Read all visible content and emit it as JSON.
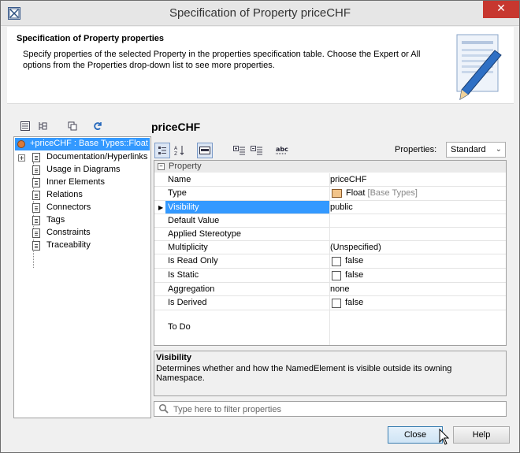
{
  "window": {
    "title": "Specification of Property priceCHF",
    "close_glyph": "✕"
  },
  "header": {
    "title": "Specification of Property properties",
    "description": "Specify properties of the selected Property in the properties specification table. Choose the Expert or All options from the Properties drop-down list to see more properties."
  },
  "tree": {
    "root_label": "+priceCHF : Base Types::Float",
    "items": [
      {
        "label": "Documentation/Hyperlinks",
        "has_expander": true
      },
      {
        "label": "Usage in Diagrams"
      },
      {
        "label": "Inner Elements"
      },
      {
        "label": "Relations"
      },
      {
        "label": "Connectors"
      },
      {
        "label": "Tags"
      },
      {
        "label": "Constraints"
      },
      {
        "label": "Traceability"
      }
    ]
  },
  "panel": {
    "element_name": "priceCHF",
    "properties_label": "Properties:",
    "properties_mode": "Standard",
    "group_label": "Property",
    "rows": {
      "name": {
        "label": "Name",
        "value": "priceCHF"
      },
      "type": {
        "label": "Type",
        "value": "Float",
        "qualifier": "[Base Types]"
      },
      "visibility": {
        "label": "Visibility",
        "value": "public"
      },
      "default_value": {
        "label": "Default Value",
        "value": ""
      },
      "applied_stereotype": {
        "label": "Applied Stereotype",
        "value": ""
      },
      "multiplicity": {
        "label": "Multiplicity",
        "value": "(Unspecified)"
      },
      "is_read_only": {
        "label": "Is Read Only",
        "value": "false"
      },
      "is_static": {
        "label": "Is Static",
        "value": "false"
      },
      "aggregation": {
        "label": "Aggregation",
        "value": "none"
      },
      "is_derived": {
        "label": "Is Derived",
        "value": "false"
      },
      "to_do": {
        "label": "To Do",
        "value": ""
      }
    },
    "description": {
      "title": "Visibility",
      "text": "Determines whether and how the NamedElement is visible outside its owning Namespace."
    },
    "filter": {
      "placeholder": "Type here to filter properties"
    },
    "toolbar_labels": {
      "abc": "abc"
    }
  },
  "footer": {
    "close_label": "Close",
    "help_label": "Help"
  },
  "colors": {
    "selection": "#3399ff",
    "close_button": "#c7372f"
  }
}
